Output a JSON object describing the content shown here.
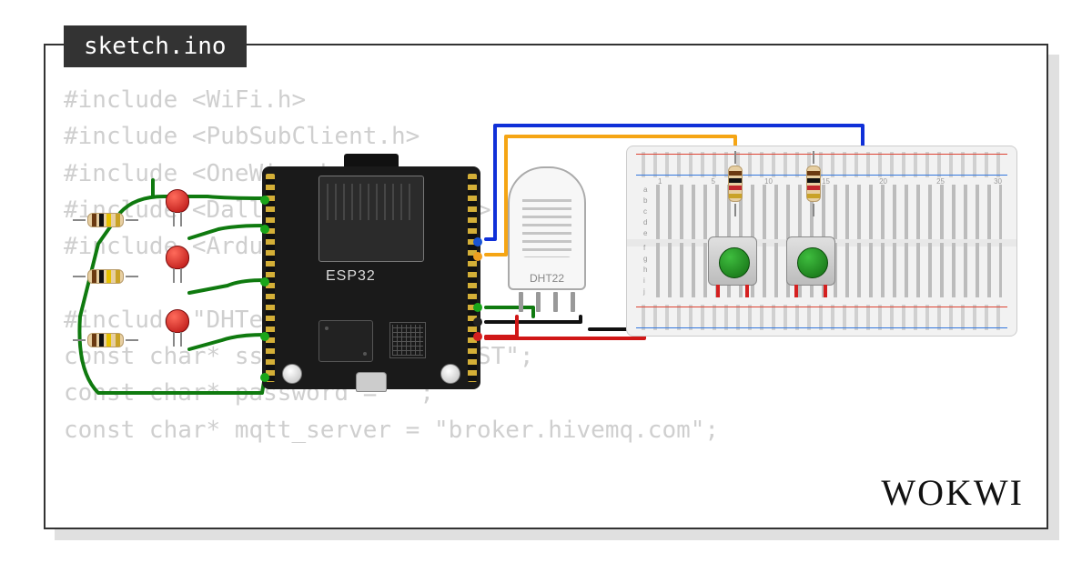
{
  "tab": {
    "filename": "sketch.ino"
  },
  "code": {
    "text": "#include <WiFi.h>\n#include <PubSubClient.h>\n#include <OneWire.h>\n#include <DallasTemperature.h>\n#include <ArduinoJson.h>\n\n#include \"DHTesp.h\"\nconst char* ssid = \"Wokwi-GUEST\";\nconst char* password = \"\";\nconst char* mqtt_server = \"broker.hivemq.com\";"
  },
  "logo": {
    "text": "WOKWI"
  },
  "components": {
    "esp32": {
      "label": "ESP32"
    },
    "dht22": {
      "label": "DHT22"
    },
    "breadboard": {
      "row_labels_top": [
        "a",
        "b",
        "c",
        "d",
        "e"
      ],
      "row_labels_bottom": [
        "f",
        "g",
        "h",
        "i",
        "j"
      ],
      "col_labels": [
        "1",
        "5",
        "10",
        "15",
        "20",
        "25",
        "30"
      ]
    },
    "buttons": [
      {
        "name": "button-1",
        "color": "green"
      },
      {
        "name": "button-2",
        "color": "green"
      }
    ],
    "leds": [
      {
        "name": "led-1",
        "color": "red"
      },
      {
        "name": "led-2",
        "color": "red"
      },
      {
        "name": "led-3",
        "color": "red"
      }
    ],
    "resistors": [
      {
        "name": "r-led-1"
      },
      {
        "name": "r-led-2"
      },
      {
        "name": "r-led-3"
      },
      {
        "name": "r-btn-1"
      },
      {
        "name": "r-btn-2"
      }
    ]
  },
  "wires": {
    "colors": {
      "green": "#0f7a0f",
      "blue": "#1030d8",
      "orange": "#f5a514",
      "black": "#101010",
      "red": "#d01717"
    }
  }
}
